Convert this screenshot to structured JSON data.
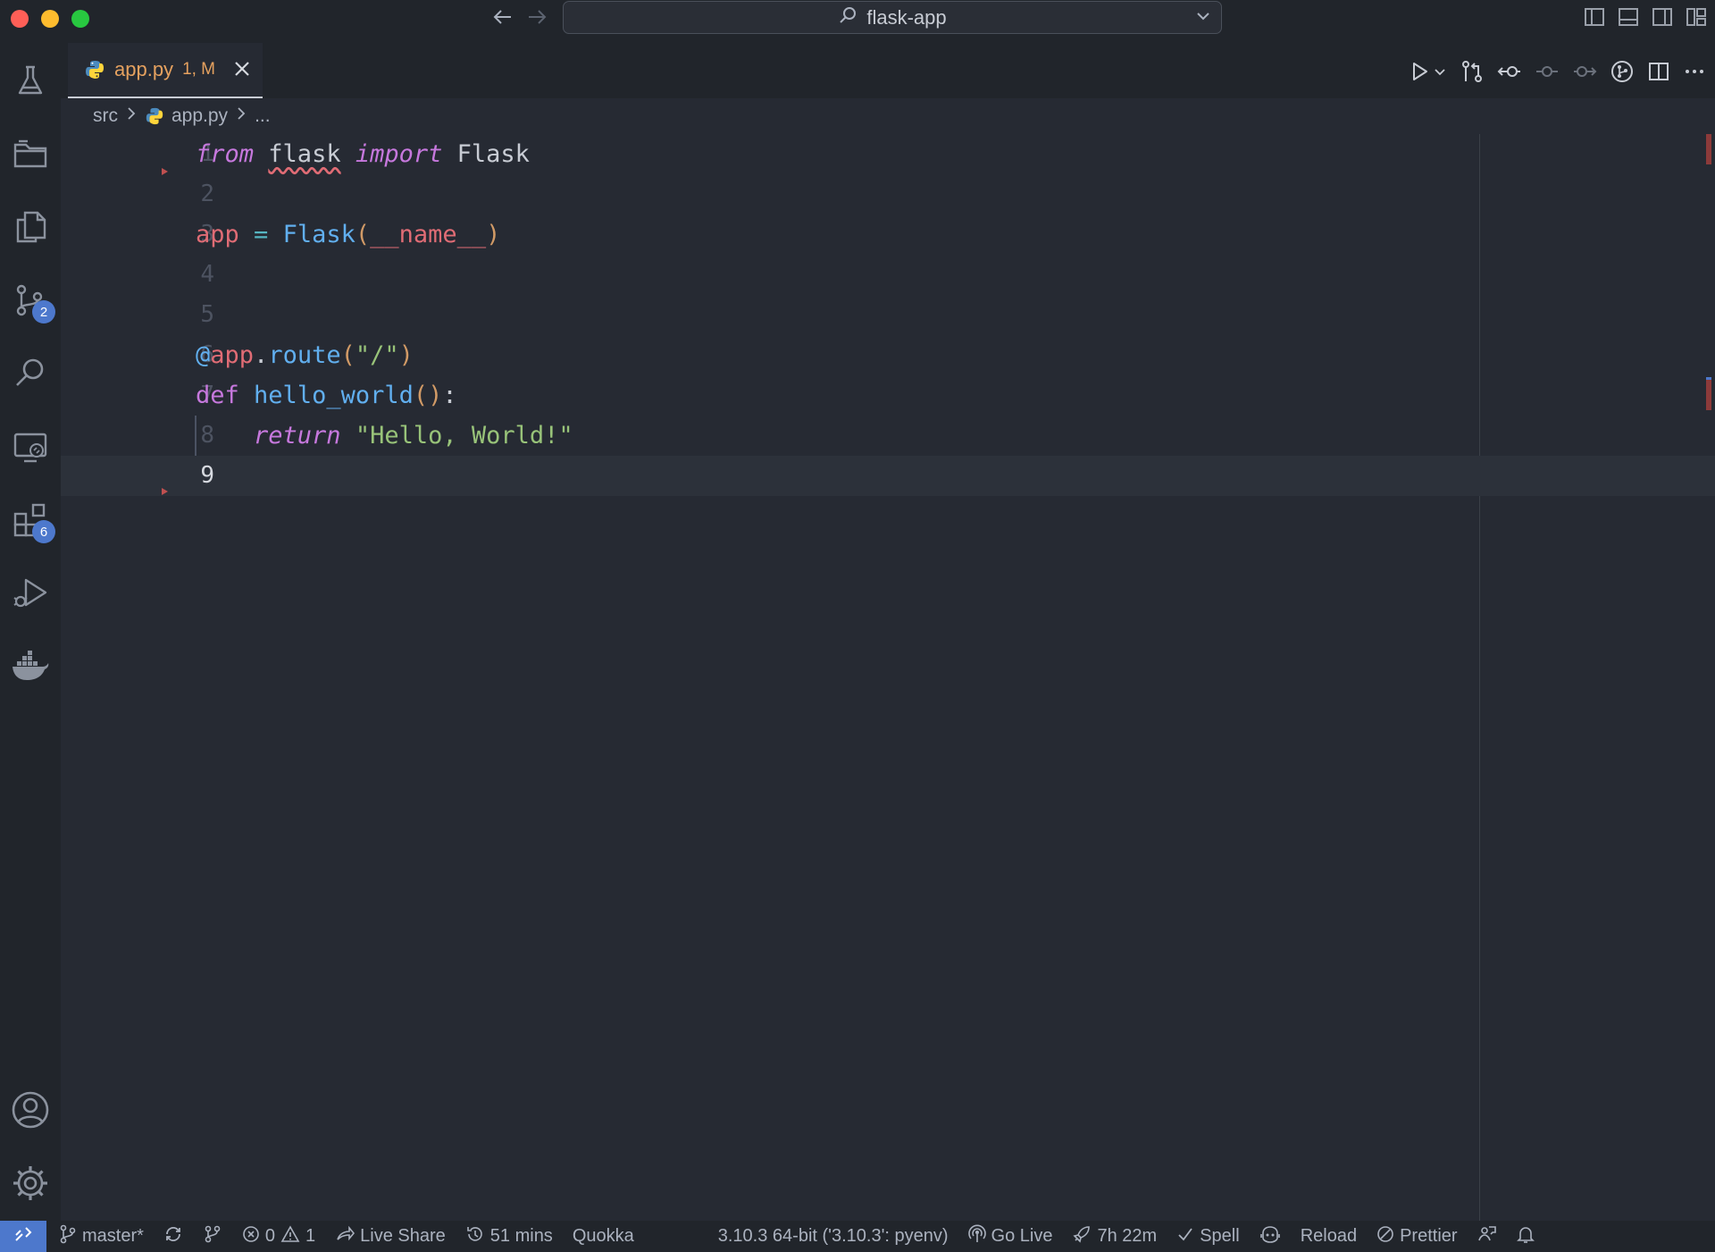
{
  "window": {
    "search_text": "flask-app"
  },
  "activity_bar": {
    "scm_badge": "2",
    "extensions_badge": "6"
  },
  "tab": {
    "name": "app.py",
    "flags": "1, M"
  },
  "breadcrumb": {
    "folder": "src",
    "file": "app.py",
    "symbol": "..."
  },
  "code": {
    "line_numbers": [
      "1",
      "2",
      "3",
      "4",
      "5",
      "6",
      "7",
      "8",
      "9"
    ],
    "l1_from": "from",
    "l1_module": "flask",
    "l1_import": "import",
    "l1_name": "Flask",
    "l3_var": "app",
    "l3_eq": "=",
    "l3_call": "Flask",
    "l3_open": "(",
    "l3_arg": "__name__",
    "l3_close": ")",
    "l6_at": "@",
    "l6_obj": "app",
    "l6_dot": ".",
    "l6_method": "route",
    "l6_open": "(",
    "l6_str": "\"/\"",
    "l6_close": ")",
    "l7_def": "def",
    "l7_name": "hello_world",
    "l7_parens": "()",
    "l7_colon": ":",
    "l8_return": "return",
    "l8_str": "\"Hello, World!\""
  },
  "statusbar": {
    "branch": "master*",
    "errors": "0",
    "warnings": "1",
    "live_share": "Live Share",
    "time_tracker": "51 mins",
    "quokka": "Quokka",
    "python": "3.10.3 64-bit ('3.10.3': pyenv)",
    "go_live": "Go Live",
    "rocket_time": "7h 22m",
    "spell": "Spell",
    "reload": "Reload",
    "prettier": "Prettier"
  },
  "colors": {
    "background": "#262a33",
    "keyword": "#c678dd",
    "function": "#61afef",
    "variable": "#e06c75",
    "string": "#98c379",
    "tab_modified": "#e5a15f",
    "badge": "#4d78cc"
  }
}
